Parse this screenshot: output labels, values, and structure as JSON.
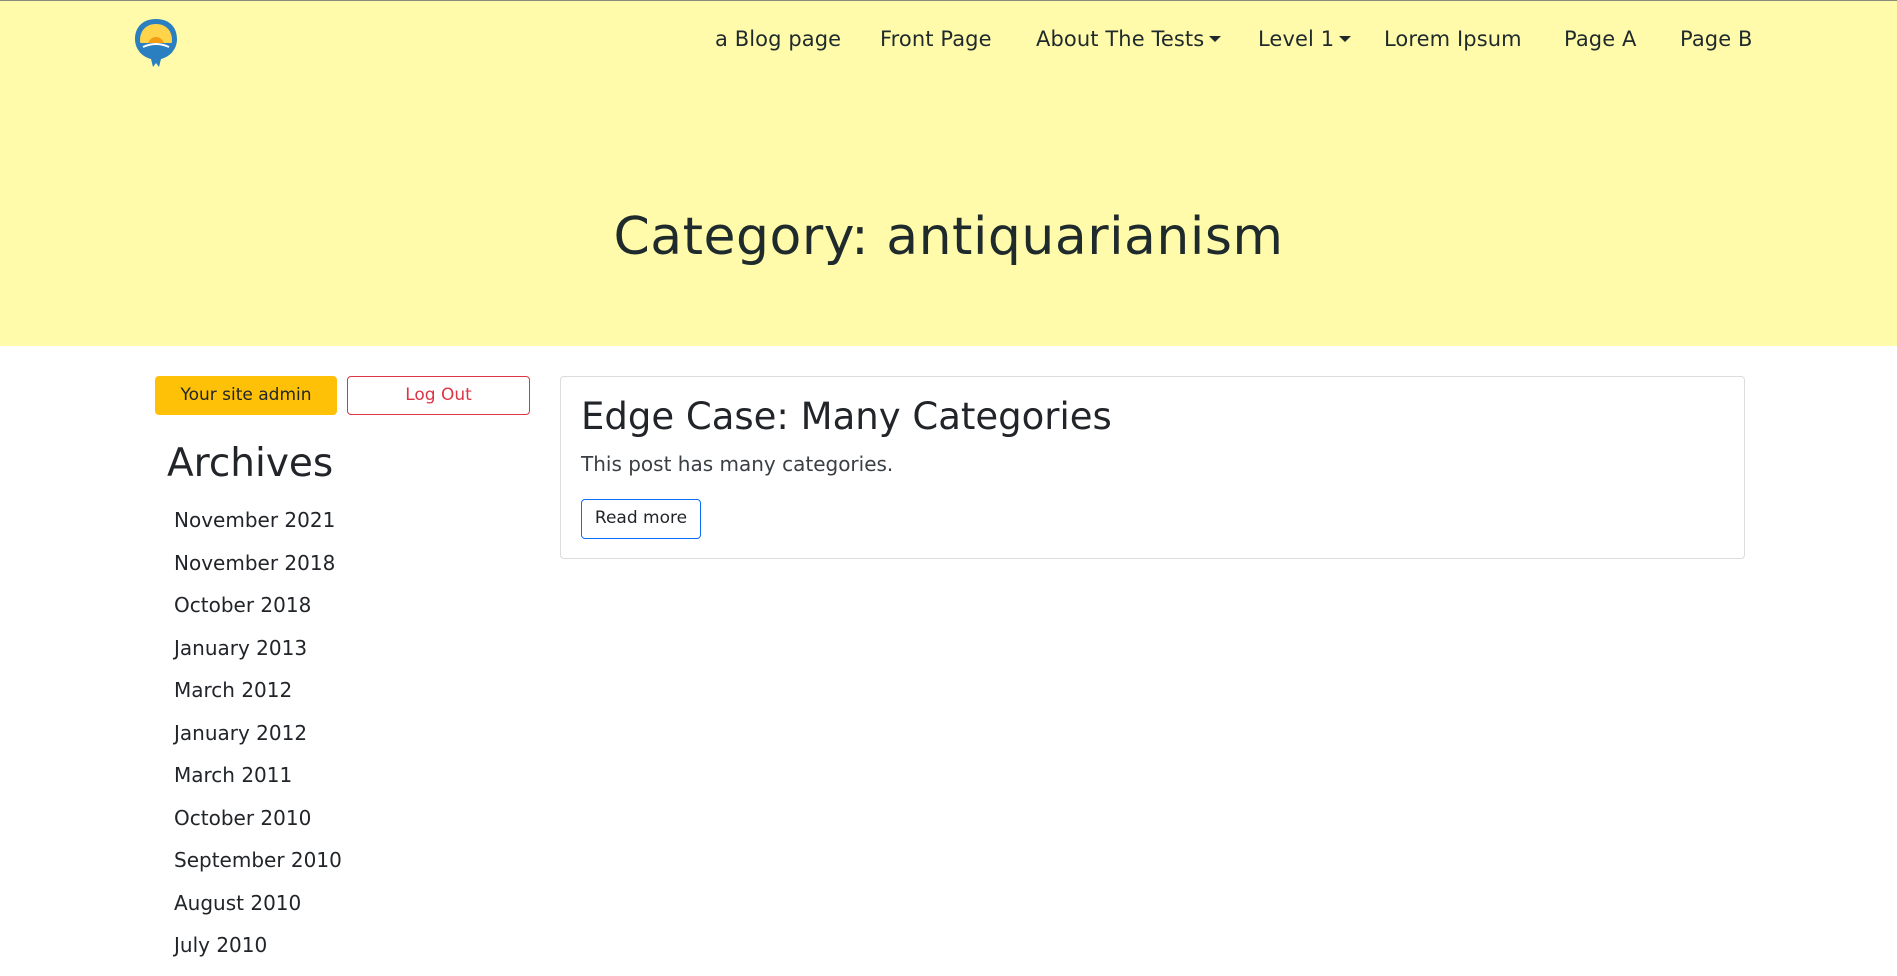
{
  "nav": {
    "items": [
      {
        "label": "a Blog page",
        "dropdown": false
      },
      {
        "label": "Front Page",
        "dropdown": false
      },
      {
        "label": "About The Tests",
        "dropdown": true
      },
      {
        "label": "Level 1",
        "dropdown": true
      },
      {
        "label": "Lorem Ipsum",
        "dropdown": false
      },
      {
        "label": "Page A",
        "dropdown": false
      },
      {
        "label": "Page B",
        "dropdown": false
      }
    ]
  },
  "header": {
    "title": "Category: antiquarianism",
    "background_color": "#fffbaa",
    "logo_icon": "site-logo-icon"
  },
  "sidebar": {
    "admin_button": "Your site admin",
    "logout_button": "Log Out",
    "archives_title": "Archives",
    "archives": [
      "November 2021",
      "November 2018",
      "October 2018",
      "January 2013",
      "March 2012",
      "January 2012",
      "March 2011",
      "October 2010",
      "September 2010",
      "August 2010",
      "July 2010"
    ]
  },
  "post": {
    "title": "Edge Case: Many Categories",
    "excerpt": "This post has many categories.",
    "read_more": "Read more"
  },
  "colors": {
    "accent_warning": "#ffc107",
    "danger": "#dc3545",
    "primary": "#0d6efd"
  }
}
